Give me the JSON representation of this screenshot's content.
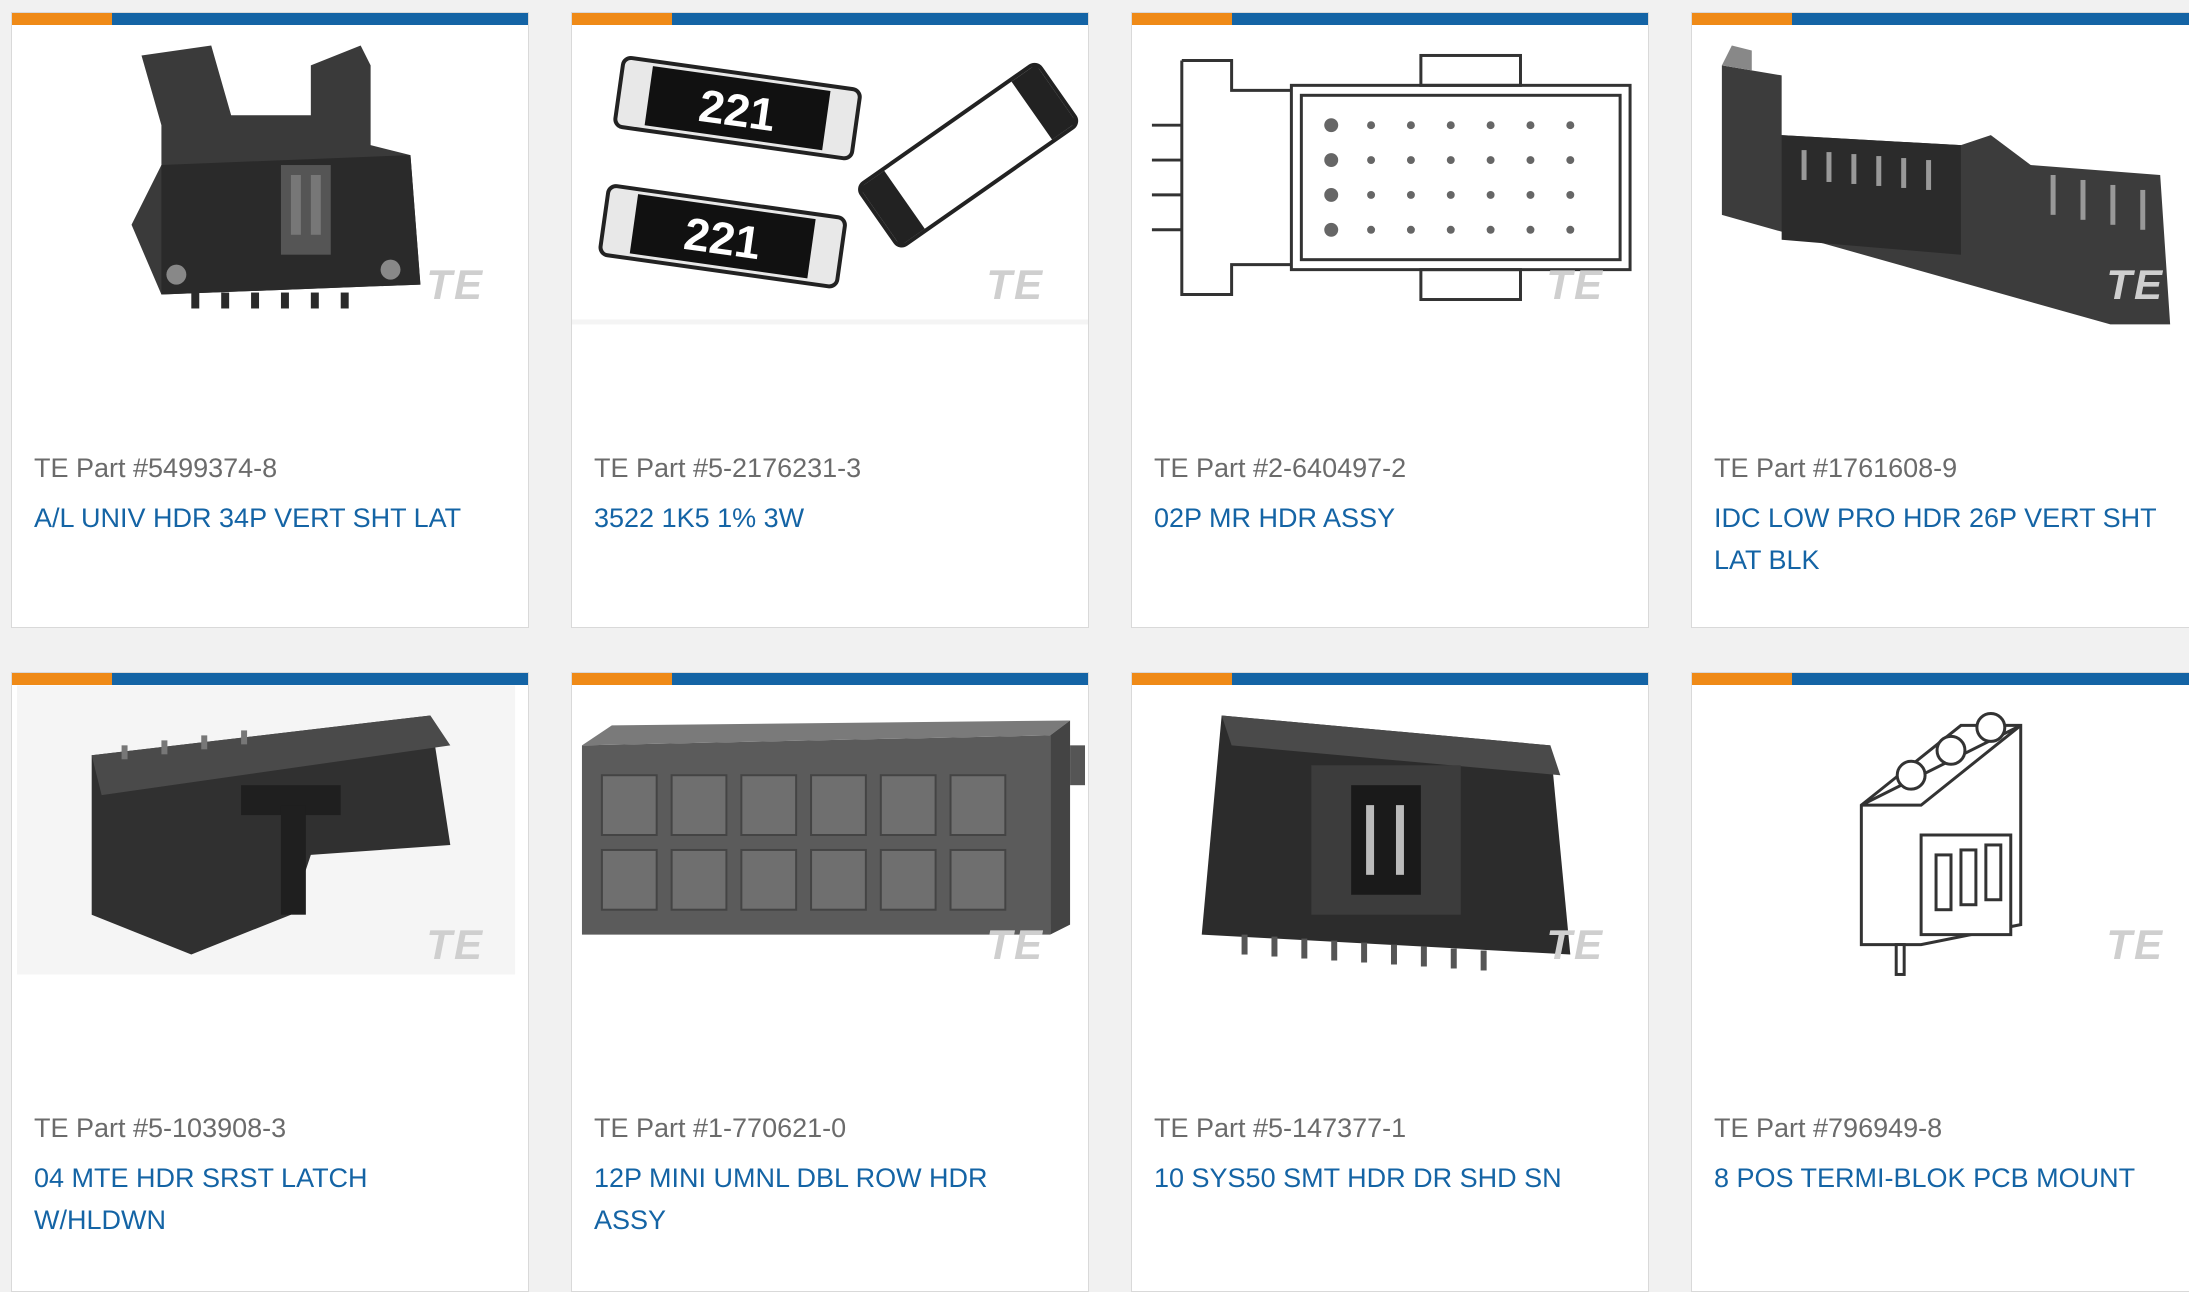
{
  "products": [
    {
      "part": "TE Part #5499374-8",
      "title": "A/L UNIV HDR 34P VERT SHT LAT",
      "icon": "connector-header-image"
    },
    {
      "part": "TE Part #5-2176231-3",
      "title": "3522 1K5 1% 3W",
      "icon": "resistor-image",
      "chip_marking": "221"
    },
    {
      "part": "TE Part #2-640497-2",
      "title": "02P MR HDR ASSY",
      "icon": "header-assembly-drawing"
    },
    {
      "part": "TE Part #1761608-9",
      "title": "IDC LOW PRO HDR 26P VERT SHT LAT BLK",
      "icon": "idc-header-image"
    },
    {
      "part": "TE Part #5-103908-3",
      "title": "04 MTE HDR SRST LATCH W/HLDWN",
      "icon": "mte-header-image"
    },
    {
      "part": "TE Part #1-770621-0",
      "title": "12P MINI UMNL DBL ROW HDR ASSY",
      "icon": "mini-header-image"
    },
    {
      "part": "TE Part #5-147377-1",
      "title": "10 SYS50 SMT HDR DR SHD SN",
      "icon": "smt-header-image"
    },
    {
      "part": "TE Part #796949-8",
      "title": "8 POS TERMI-BLOK PCB MOUNT",
      "icon": "terminal-block-drawing"
    }
  ],
  "logo_text": "TE",
  "colors": {
    "accent_orange": "#ef8a17",
    "accent_blue": "#1464a5",
    "link": "#1464a5"
  }
}
